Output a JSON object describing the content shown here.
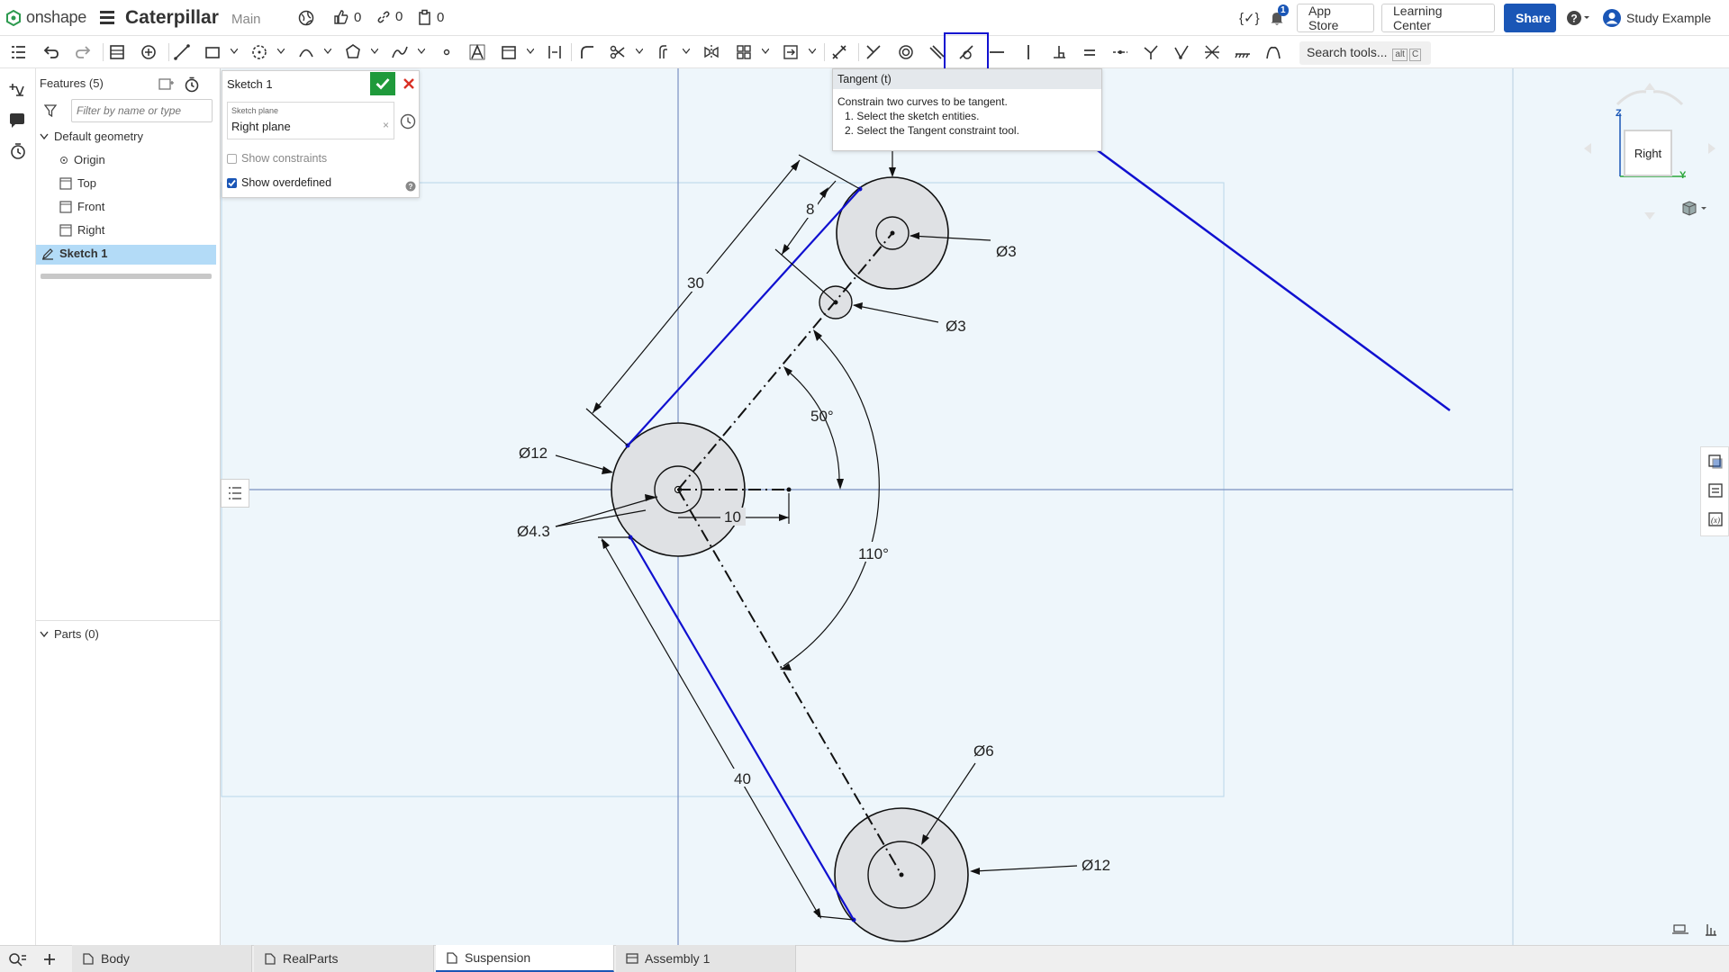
{
  "app": {
    "logo_text": "onshape",
    "doc_title": "Caterpillar",
    "branch": "Main",
    "likes": "0",
    "links": "0",
    "copies": "0",
    "notif_count": "1",
    "app_store": "App Store",
    "learning_center": "Learning Center",
    "share": "Share",
    "user": "Study Example",
    "code_icon_label": "{✓}"
  },
  "toolbar": {
    "search_label": "Search tools...",
    "search_shortcut_1": "alt",
    "search_shortcut_2": "C",
    "highlighted_tool": "tangent-tool"
  },
  "tooltip": {
    "title": "Tangent (t)",
    "description": "Constrain two curves to be tangent.",
    "step1": "1. Select the sketch entities.",
    "step2": "2. Select the Tangent constraint tool."
  },
  "feature_panel": {
    "title": "Features (5)",
    "filter_placeholder": "Filter by name or type",
    "default_geometry": "Default geometry",
    "items": [
      {
        "label": "Origin",
        "icon": "origin-icon"
      },
      {
        "label": "Top",
        "icon": "plane-icon"
      },
      {
        "label": "Front",
        "icon": "plane-icon"
      },
      {
        "label": "Right",
        "icon": "plane-icon"
      }
    ],
    "sketch": "Sketch 1",
    "parts": "Parts (0)"
  },
  "sketch_dialog": {
    "title": "Sketch 1",
    "plane_label": "Sketch plane",
    "plane_value": "Right plane",
    "clear": "×",
    "show_constraints": "Show constraints",
    "show_constraints_checked": false,
    "show_overdefined": "Show overdefined",
    "show_overdefined_checked": true
  },
  "viewcube": {
    "face": "Right",
    "axis_z": "Z",
    "axis_y": "Y"
  },
  "dimensions": {
    "d_len_30": "30",
    "d_len_8": "8",
    "d_dia3_top": "Ø3",
    "d_dia3_mid": "Ø3",
    "d_ang_50": "50°",
    "d_dia12_left": "Ø12",
    "d_dia43": "Ø4.3",
    "d_len_10": "10",
    "d_ang_110": "110°",
    "d_len_40": "40",
    "d_dia6": "Ø6",
    "d_dia12_bottom": "Ø12"
  },
  "colors": {
    "accent": "#1a56b6",
    "sketch_blue": "#1010d0",
    "canvas": "#eef6fb",
    "ok_green": "#1f9a3b",
    "circle_fill": "#dfe1e4"
  },
  "bottom_tabs": [
    {
      "label": "Body",
      "active": false
    },
    {
      "label": "RealParts",
      "active": false
    },
    {
      "label": "Suspension",
      "active": true
    },
    {
      "label": "Assembly 1",
      "active": false
    }
  ]
}
